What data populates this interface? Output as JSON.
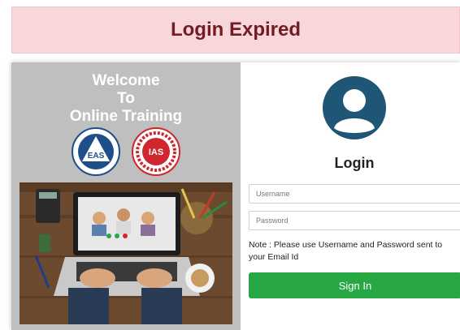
{
  "alert": {
    "text": "Login Expired"
  },
  "welcome": {
    "line1": "Welcome",
    "line2": "To",
    "line3": "Online Training"
  },
  "logos": {
    "eas": {
      "text": "EAS",
      "ring_text": "ENVIRONMENTAL ASSESSMENT SYSTEMS"
    },
    "ias": {
      "text": "IAS",
      "ring_text": "INTEGRATED ASSESSMENT SERVICES"
    }
  },
  "login": {
    "title": "Login",
    "username_placeholder": "Username",
    "password_placeholder": "Password",
    "note": "Note : Please use Username and Password sent to your Email Id",
    "signin_label": "Sign In"
  },
  "colors": {
    "alert_bg": "#f8d7da",
    "alert_text": "#721c24",
    "left_panel": "#bfbfbf",
    "avatar": "#1f5575",
    "signin_green": "#28a745"
  }
}
